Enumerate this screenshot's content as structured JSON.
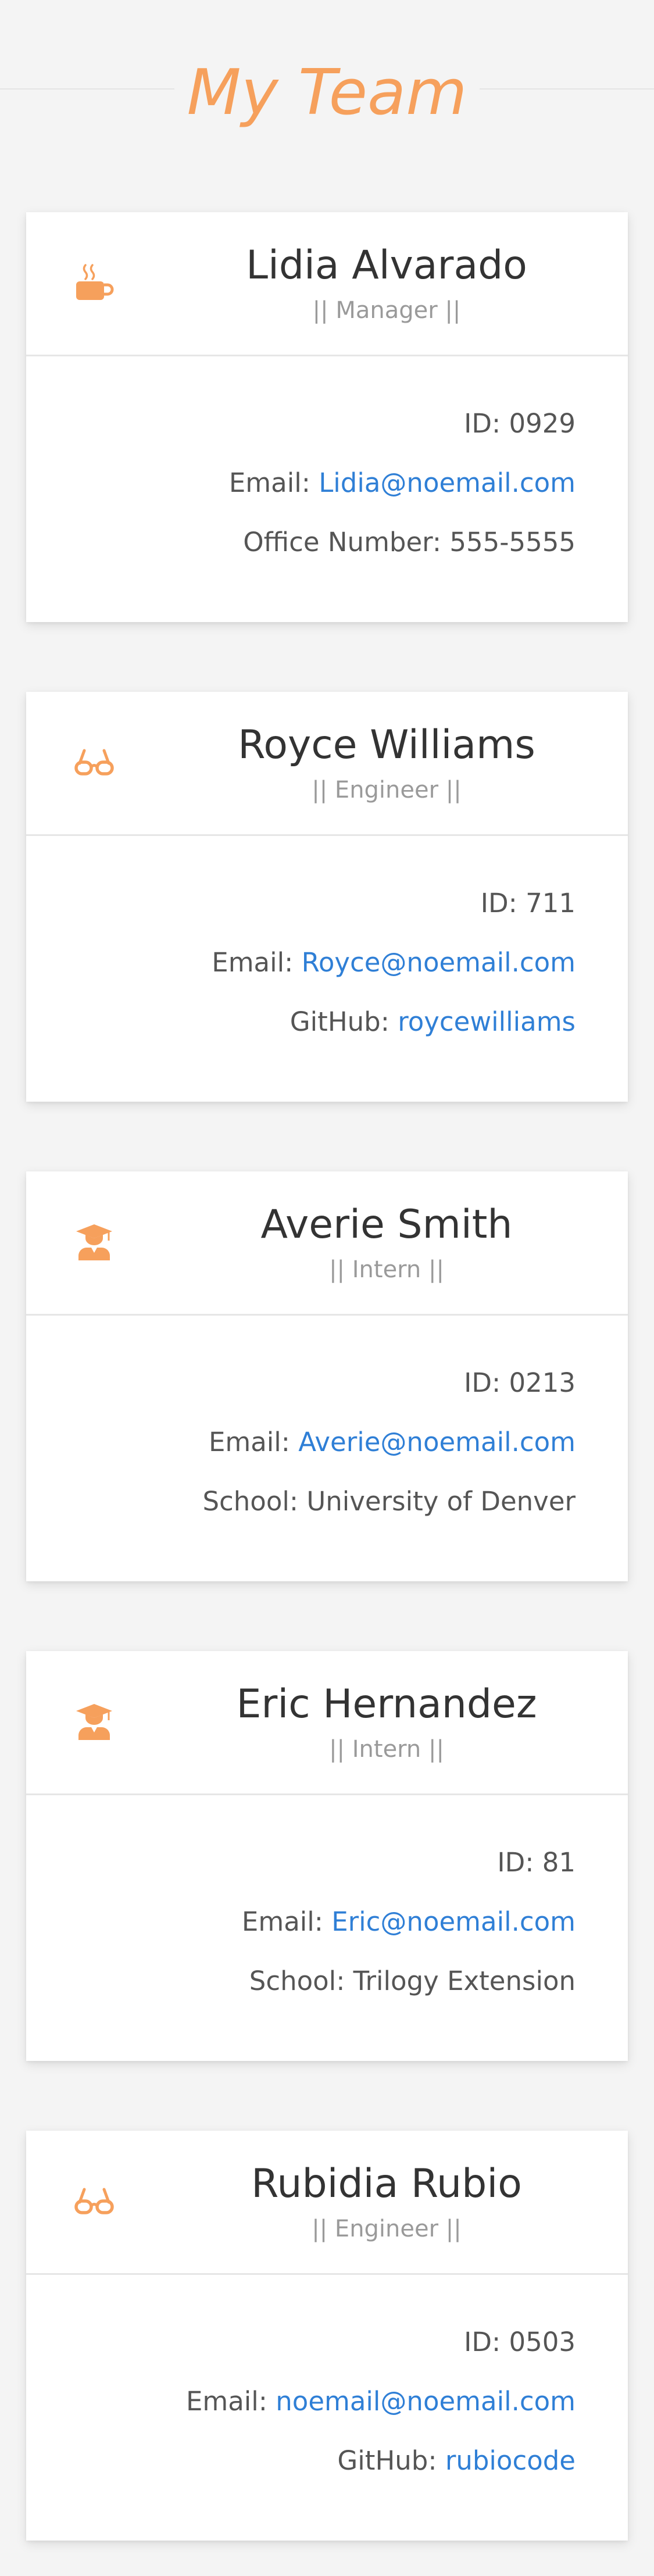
{
  "header": {
    "title": "My Team"
  },
  "colors": {
    "accent": "#f6a05c",
    "link": "#2f7fd6",
    "text": "#555555"
  },
  "labels": {
    "id": "ID:",
    "email": "Email:",
    "office": "Office Number:",
    "github": "GitHub:",
    "school": "School:"
  },
  "team": [
    {
      "name": "Lidia Alvarado",
      "role": "|| Manager ||",
      "icon": "coffee-mug-icon",
      "id": "0929",
      "email": "Lidia@noemail.com",
      "office": "555-5555"
    },
    {
      "name": "Royce Williams",
      "role": "|| Engineer ||",
      "icon": "glasses-icon",
      "id": "711",
      "email": "Royce@noemail.com",
      "github": "roycewilliams"
    },
    {
      "name": "Averie Smith",
      "role": "|| Intern ||",
      "icon": "graduate-icon",
      "id": "0213",
      "email": "Averie@noemail.com",
      "school": "University of Denver"
    },
    {
      "name": "Eric Hernandez",
      "role": "|| Intern ||",
      "icon": "graduate-icon",
      "id": "81",
      "email": "Eric@noemail.com",
      "school": "Trilogy Extension"
    },
    {
      "name": "Rubidia Rubio",
      "role": "|| Engineer ||",
      "icon": "glasses-icon",
      "id": "0503",
      "email": "noemail@noemail.com",
      "github": "rubiocode"
    }
  ]
}
